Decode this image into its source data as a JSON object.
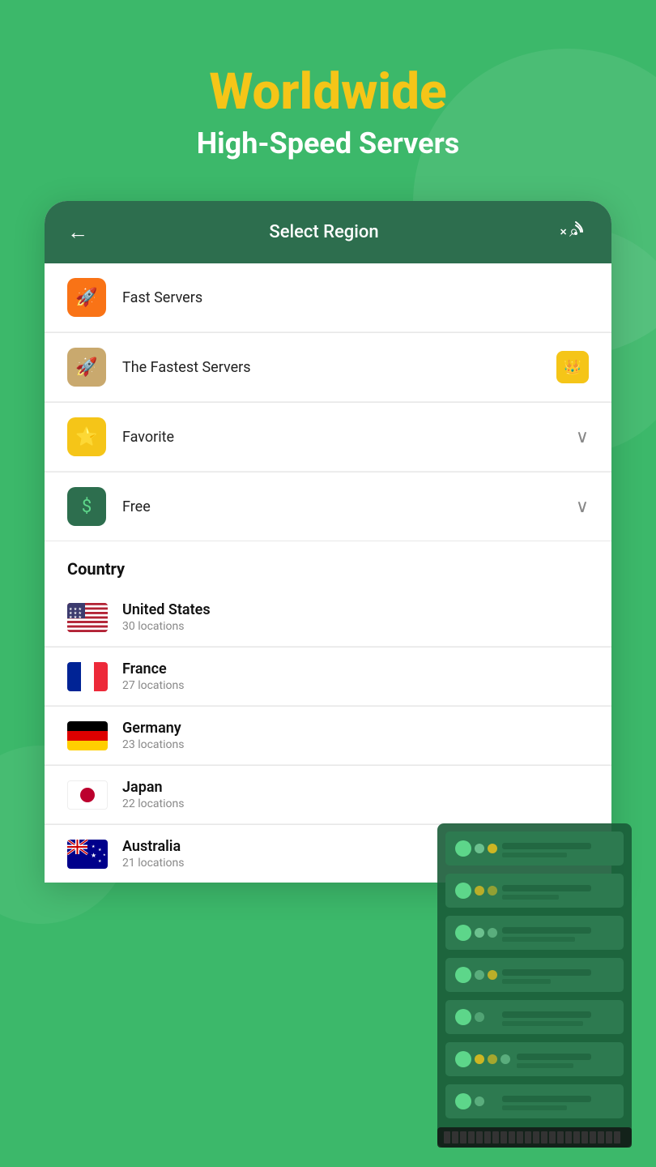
{
  "hero": {
    "title": "Worldwide",
    "subtitle": "High-Speed Servers"
  },
  "header": {
    "back_label": "←",
    "title": "Select Region"
  },
  "menu": {
    "items": [
      {
        "id": "fast-servers",
        "label": "Fast Servers",
        "icon": "🚀",
        "icon_bg": "orange",
        "right": ""
      },
      {
        "id": "fastest-servers",
        "label": "The Fastest Servers",
        "icon": "🚀",
        "icon_bg": "tan",
        "right": "crown"
      },
      {
        "id": "favorite",
        "label": "Favorite",
        "icon": "⭐",
        "icon_bg": "yellow",
        "right": "chevron"
      },
      {
        "id": "free",
        "label": "Free",
        "icon": "$",
        "icon_bg": "green",
        "right": "chevron"
      }
    ]
  },
  "country_section": {
    "header": "Country",
    "countries": [
      {
        "id": "us",
        "name": "United States",
        "locations": "30 locations",
        "flag": "us"
      },
      {
        "id": "fr",
        "name": "France",
        "locations": "27 locations",
        "flag": "fr"
      },
      {
        "id": "de",
        "name": "Germany",
        "locations": "23 locations",
        "flag": "de"
      },
      {
        "id": "jp",
        "name": "Japan",
        "locations": "22 locations",
        "flag": "jp"
      },
      {
        "id": "au",
        "name": "Australia",
        "locations": "21 locations",
        "flag": "au"
      }
    ]
  }
}
